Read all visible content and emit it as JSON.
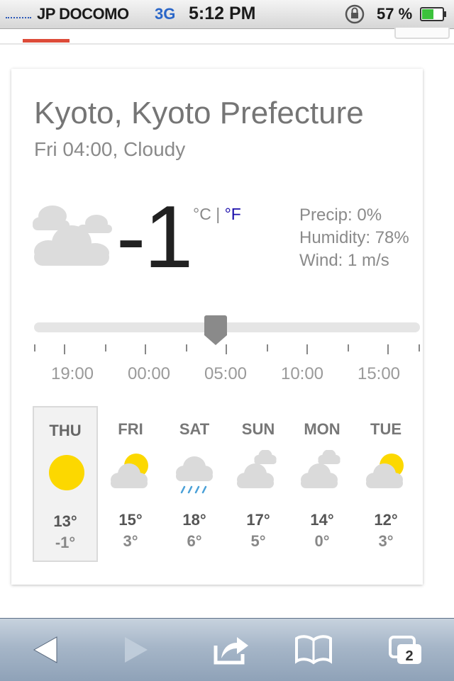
{
  "status_bar": {
    "carrier": "JP DOCOMO",
    "network": "3G",
    "time": "5:12 PM",
    "battery": "57 %"
  },
  "weather": {
    "location": "Kyoto, Kyoto Prefecture",
    "subtitle": "Fri 04:00, Cloudy",
    "current_temp": "-1",
    "unit_celsius": "°C",
    "unit_separator": "|",
    "unit_fahrenheit": "°F",
    "details": {
      "precip": "Precip: 0%",
      "humidity": "Humidity: 78%",
      "wind": "Wind: 1 m/s"
    },
    "condition_icon": "cloudy-icon",
    "slider": {
      "hours": [
        "19:00",
        "00:00",
        "05:00",
        "10:00",
        "15:00"
      ],
      "position_fraction": 0.47
    },
    "forecast": [
      {
        "day": "THU",
        "high": "13°",
        "low": "-1°",
        "icon": "sunny-icon",
        "selected": true
      },
      {
        "day": "FRI",
        "high": "15°",
        "low": "3°",
        "icon": "partly-cloudy-icon",
        "selected": false
      },
      {
        "day": "SAT",
        "high": "18°",
        "low": "6°",
        "icon": "rain-icon",
        "selected": false
      },
      {
        "day": "SUN",
        "high": "17°",
        "low": "5°",
        "icon": "cloudy-icon",
        "selected": false
      },
      {
        "day": "MON",
        "high": "14°",
        "low": "0°",
        "icon": "cloudy-icon",
        "selected": false
      },
      {
        "day": "TUE",
        "high": "12°",
        "low": "3°",
        "icon": "partly-cloudy-icon",
        "selected": false
      }
    ]
  },
  "toolbar": {
    "tab_count": "2",
    "buttons": [
      "back-icon",
      "forward-icon",
      "share-icon",
      "bookmarks-icon",
      "tabs-icon"
    ]
  },
  "colors": {
    "accent_red": "#dd4b39",
    "link_blue": "#1a0dab",
    "sun_yellow": "#fcd800",
    "cloud_gray": "#dadada",
    "rain_blue": "#4aa0d8"
  }
}
